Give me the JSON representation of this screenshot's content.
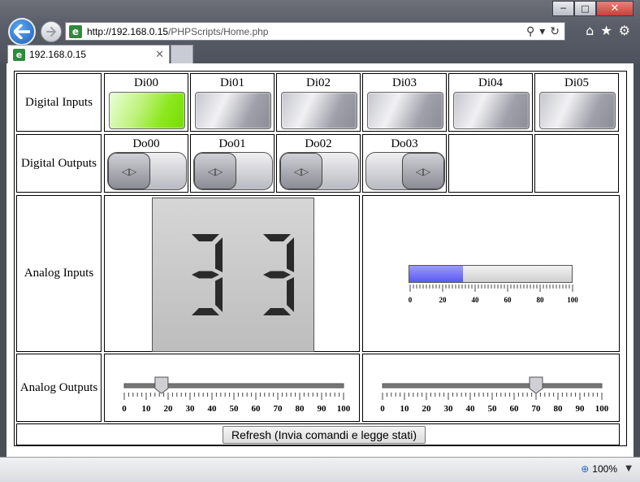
{
  "browser": {
    "url_host": "http://192.168.0.15",
    "url_path": "/PHPScripts/Home.php",
    "tab_title": "192.168.0.15",
    "zoom": "100%",
    "icons": [
      "back-icon",
      "forward-icon",
      "search-icon",
      "refresh-icon",
      "home-icon",
      "favorites-star-icon",
      "settings-gear-icon"
    ]
  },
  "page": {
    "digital_inputs": {
      "label": "Digital Inputs",
      "items": [
        {
          "name": "Di00",
          "on": true
        },
        {
          "name": "Di01",
          "on": false
        },
        {
          "name": "Di02",
          "on": false
        },
        {
          "name": "Di03",
          "on": false
        },
        {
          "name": "Di04",
          "on": false
        },
        {
          "name": "Di05",
          "on": false
        }
      ],
      "on_color": "#8ce81e"
    },
    "digital_outputs": {
      "label": "Digital Outputs",
      "items": [
        {
          "name": "Do00",
          "on": false
        },
        {
          "name": "Do01",
          "on": false
        },
        {
          "name": "Do02",
          "on": false
        },
        {
          "name": "Do03",
          "on": true
        }
      ]
    },
    "analog_inputs": {
      "label": "Analog Inputs",
      "display_value": "33",
      "bar_value": 33,
      "bar_scale": [
        "0",
        "20",
        "40",
        "60",
        "80",
        "100"
      ],
      "bar_color": "#6b6bff"
    },
    "analog_outputs": {
      "label": "Analog Outputs",
      "sliders": [
        {
          "value": 17
        },
        {
          "value": 70
        }
      ],
      "scale": [
        "0",
        "10",
        "20",
        "30",
        "40",
        "50",
        "60",
        "70",
        "80",
        "90",
        "100"
      ]
    },
    "refresh_button": "Refresh (Invia comandi e legge stati)"
  }
}
